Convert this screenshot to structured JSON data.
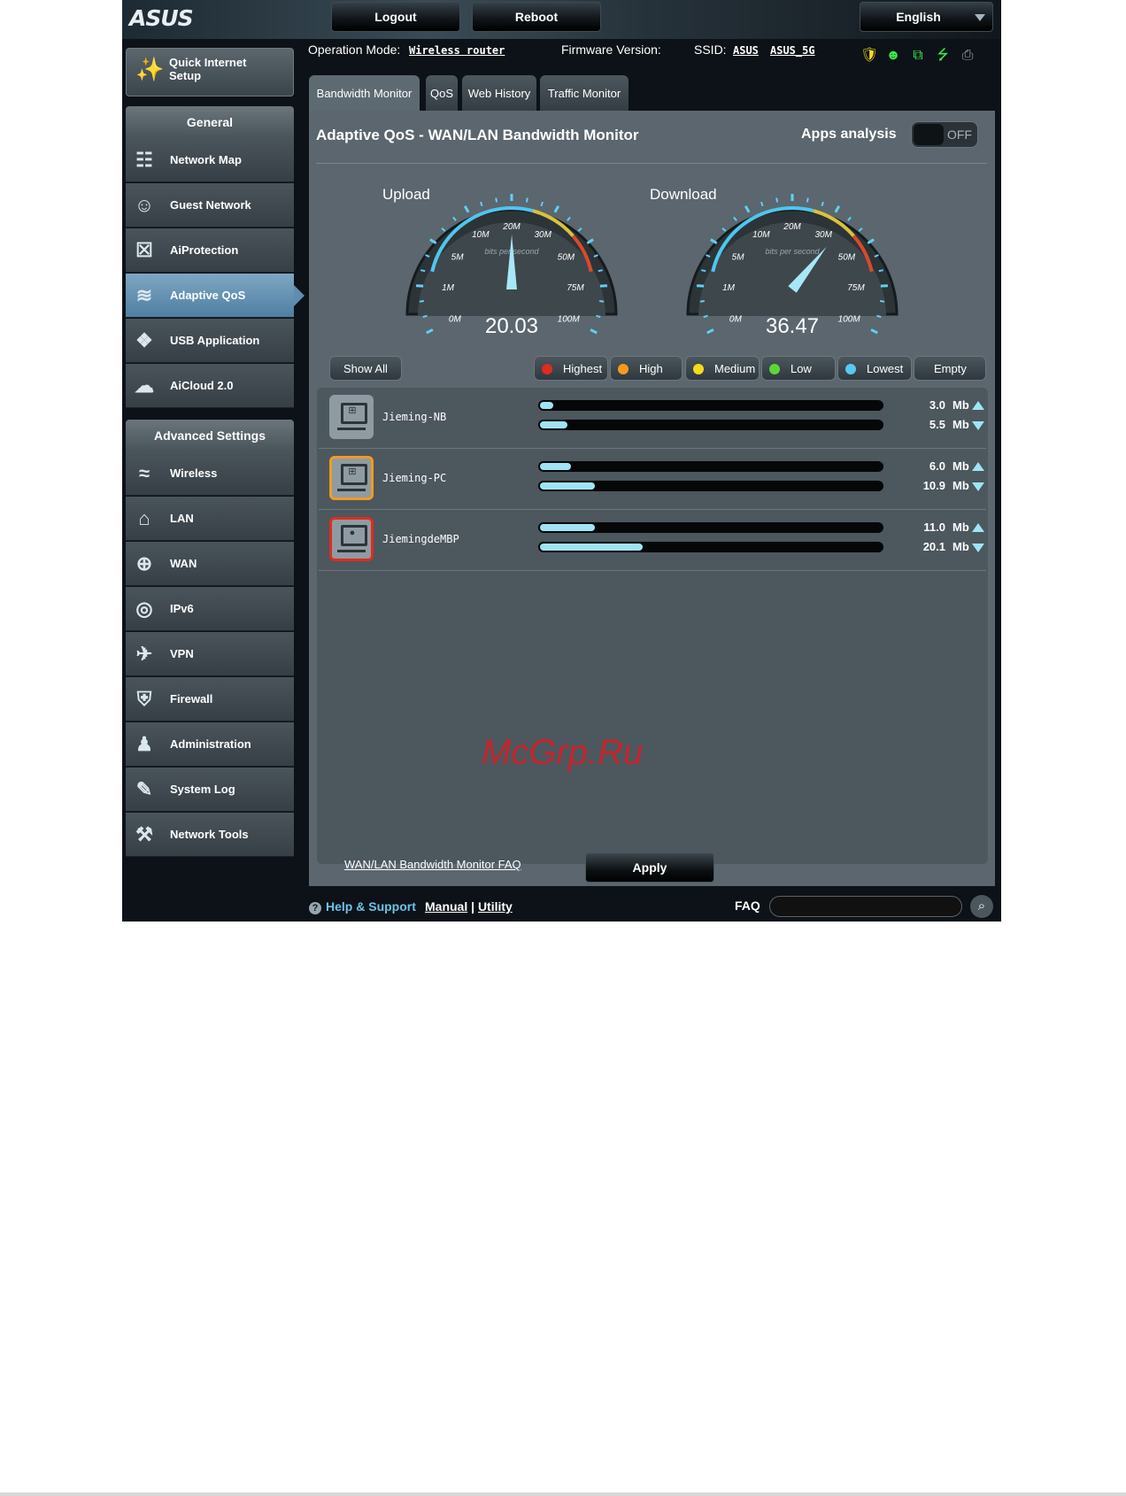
{
  "header": {
    "logo": "ASUS",
    "logout": "Logout",
    "reboot": "Reboot",
    "language": "English"
  },
  "status": {
    "operation_mode_label": "Operation Mode:",
    "operation_mode": "Wireless router",
    "firmware_label": "Firmware Version:",
    "ssid_label": "SSID:",
    "ssid_1": "ASUS",
    "ssid_2": "ASUS_5G"
  },
  "sidebar": {
    "quick_setup": "Quick Internet Setup",
    "general_header": "General",
    "general_items": [
      {
        "label": "Network Map",
        "icon": "network-map-icon"
      },
      {
        "label": "Guest Network",
        "icon": "guest-network-icon"
      },
      {
        "label": "AiProtection",
        "icon": "lock-icon"
      },
      {
        "label": "Adaptive QoS",
        "icon": "qos-icon"
      },
      {
        "label": "USB Application",
        "icon": "puzzle-icon"
      },
      {
        "label": "AiCloud 2.0",
        "icon": "cloud-icon"
      }
    ],
    "advanced_header": "Advanced Settings",
    "advanced_items": [
      {
        "label": "Wireless",
        "icon": "wifi-icon"
      },
      {
        "label": "LAN",
        "icon": "home-icon"
      },
      {
        "label": "WAN",
        "icon": "globe-icon"
      },
      {
        "label": "IPv6",
        "icon": "ipv6-icon"
      },
      {
        "label": "VPN",
        "icon": "vpn-icon"
      },
      {
        "label": "Firewall",
        "icon": "shield-icon"
      },
      {
        "label": "Administration",
        "icon": "user-icon"
      },
      {
        "label": "System Log",
        "icon": "edit-log-icon"
      },
      {
        "label": "Network Tools",
        "icon": "tools-icon"
      }
    ],
    "active": "Adaptive QoS"
  },
  "tabs": [
    "Bandwidth Monitor",
    "QoS",
    "Web History",
    "Traffic Monitor"
  ],
  "main": {
    "title": "Adaptive QoS - WAN/LAN Bandwidth Monitor",
    "apps_analysis_label": "Apps analysis",
    "apps_analysis_state": "OFF",
    "upload_label": "Upload",
    "download_label": "Download",
    "gauge_caption": "bits per second",
    "gauge_ticks": [
      "0M",
      "1M",
      "5M",
      "10M",
      "20M",
      "30M",
      "50M",
      "75M",
      "100M"
    ],
    "upload_value": "20.03",
    "download_value": "36.47",
    "filters": {
      "show_all": "Show All",
      "highest": "Highest",
      "high": "High",
      "medium": "Medium",
      "low": "Low",
      "lowest": "Lowest",
      "empty": "Empty"
    },
    "priority_colors": {
      "highest": "#e02b20",
      "high": "#f29b20",
      "medium": "#f3dc1b",
      "low": "#5ed43a",
      "lowest": "#5bc8ef"
    },
    "clients": [
      {
        "name": "Jieming-NB",
        "os": "windows",
        "border": "#8f9ba2",
        "up": "3.0",
        "down": "5.5",
        "up_frac": 0.04,
        "down_frac": 0.08
      },
      {
        "name": "Jieming-PC",
        "os": "windows",
        "border": "#f29b20",
        "up": "6.0",
        "down": "10.9",
        "up_frac": 0.09,
        "down_frac": 0.16
      },
      {
        "name": "JiemingdeMBP",
        "os": "apple",
        "border": "#e02b20",
        "up": "11.0",
        "down": "20.1",
        "up_frac": 0.16,
        "down_frac": 0.3
      }
    ],
    "unit": "Mb",
    "faq_link": "WAN/LAN Bandwidth Monitor FAQ",
    "apply": "Apply",
    "watermark": "McGrp.Ru"
  },
  "footer": {
    "help": "Help & Support",
    "manual": "Manual",
    "sep": "|",
    "utility": "Utility",
    "faq_label": "FAQ",
    "faq_placeholder": ""
  },
  "gauges": {
    "upload_mbps": 20.03,
    "download_mbps": 36.47,
    "max_mbps": 100
  }
}
